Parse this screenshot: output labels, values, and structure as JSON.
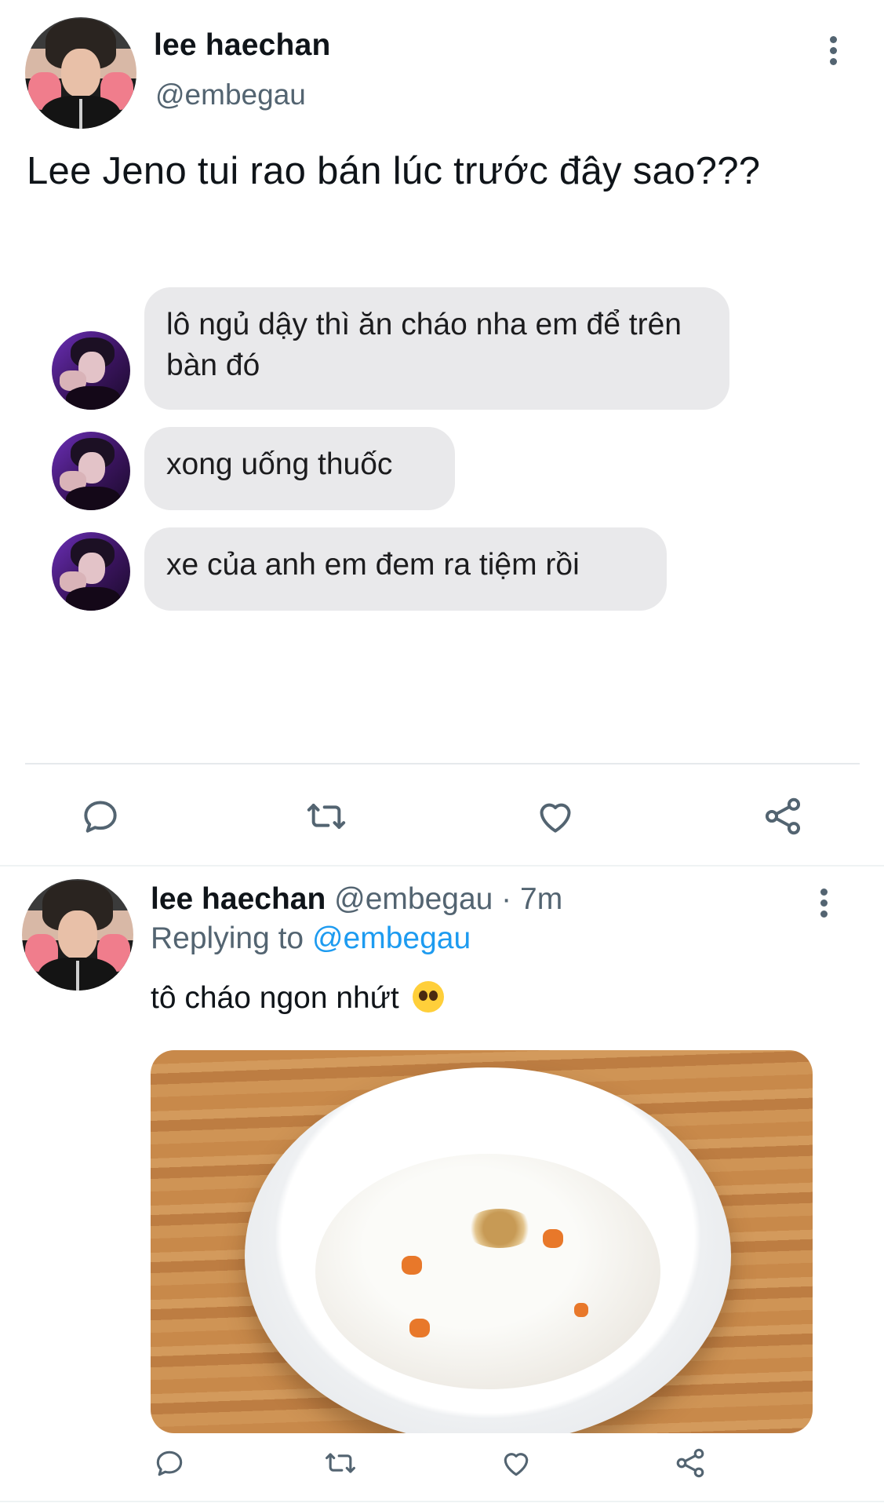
{
  "main_tweet": {
    "display_name": "lee haechan",
    "handle": "@embegau",
    "text": "Lee Jeno tui rao bán lúc trước đây sao???",
    "chat_messages": [
      "lô ngủ dậy thì ăn cháo nha em để trên bàn đó",
      "xong uống thuốc",
      "xe của anh em đem ra tiệm rồi"
    ]
  },
  "reply_tweet": {
    "display_name": "lee haechan",
    "meta": "@embegau · 7m",
    "replying_prefix": "Replying to",
    "replying_handle": "@embegau",
    "text": "tô cháo ngon nhứt"
  },
  "icons": {
    "reply": "reply-icon",
    "retweet": "retweet-icon",
    "like": "heart-icon",
    "share": "share-icon",
    "more": "more-vertical-icon"
  },
  "colors": {
    "text_primary": "#0f1419",
    "text_secondary": "#536471",
    "link": "#1d9bf0",
    "bubble_bg": "#e9e9eb"
  }
}
